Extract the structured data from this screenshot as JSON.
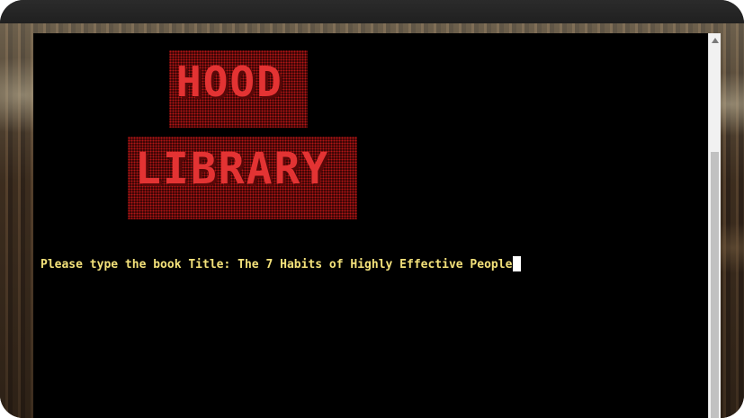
{
  "logo": {
    "line1": "HOOD",
    "line2": "LIBRARY"
  },
  "terminal": {
    "prompt": "Please type the book Title: ",
    "input_value": "The 7 Habits of Highly Effective People"
  },
  "colors": {
    "terminal_bg": "#000000",
    "prompt_text": "#f3e17a",
    "logo_red": "#e33333"
  }
}
